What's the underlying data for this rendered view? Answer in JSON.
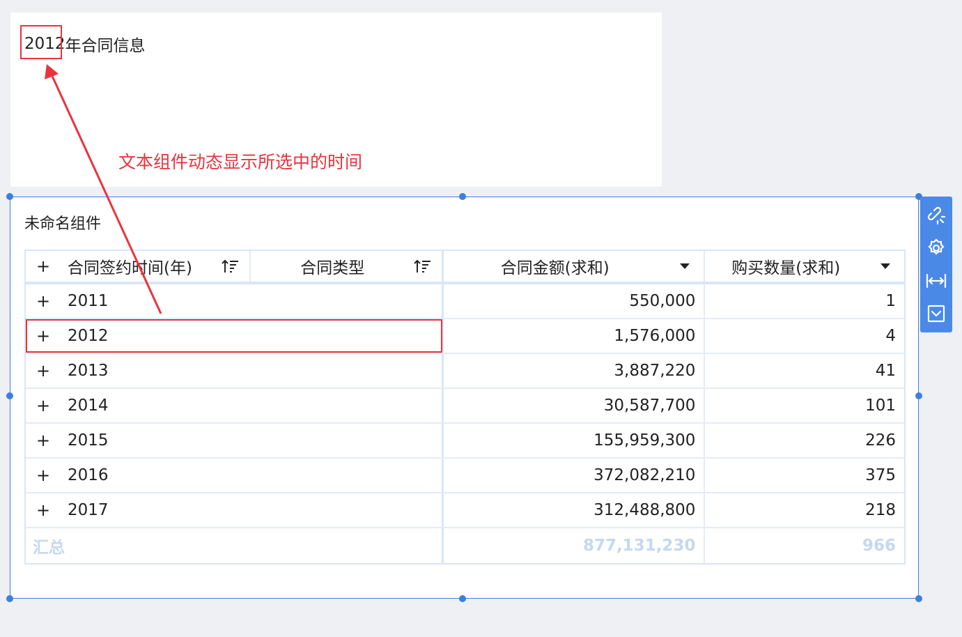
{
  "text_widget": {
    "year": "2012",
    "title_suffix": "年合同信息"
  },
  "annotation": {
    "text": "文本组件动态显示所选中的时间",
    "color": "#e8343c"
  },
  "table_widget": {
    "title": "未命名组件",
    "columns": [
      {
        "label": "合同签约时间(年)",
        "control": "sort-asc-icon"
      },
      {
        "label": "合同类型",
        "control": "sort-asc-icon"
      },
      {
        "label": "合同金额(求和)",
        "control": "dropdown-icon"
      },
      {
        "label": "购买数量(求和)",
        "control": "dropdown-icon"
      }
    ],
    "expand_symbol": "+",
    "rows": [
      {
        "year": "2011",
        "amount": "550,000",
        "quantity": "1"
      },
      {
        "year": "2012",
        "amount": "1,576,000",
        "quantity": "4"
      },
      {
        "year": "2013",
        "amount": "3,887,220",
        "quantity": "41"
      },
      {
        "year": "2014",
        "amount": "30,587,700",
        "quantity": "101"
      },
      {
        "year": "2015",
        "amount": "155,959,300",
        "quantity": "226"
      },
      {
        "year": "2016",
        "amount": "372,082,210",
        "quantity": "375"
      },
      {
        "year": "2017",
        "amount": "312,488,800",
        "quantity": "218"
      }
    ],
    "total": {
      "label": "汇总",
      "amount": "877,131,230",
      "quantity": "966"
    }
  },
  "toolbar": {
    "buttons": [
      "link-icon",
      "gear-icon",
      "fit-width-icon",
      "collapse-icon"
    ]
  },
  "colors": {
    "accent": "#3d7fe0",
    "toolbar": "#4a8ae6",
    "highlight": "#e8343c",
    "total_text": "#c5d8f2"
  }
}
